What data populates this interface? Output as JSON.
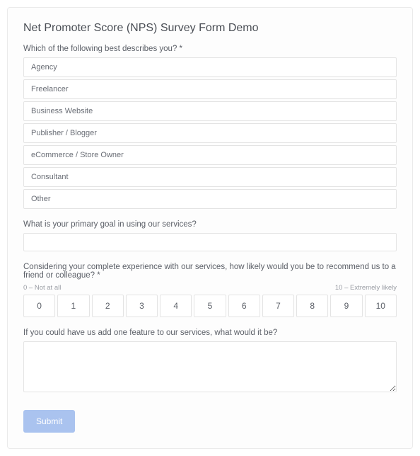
{
  "title": "Net Promoter Score (NPS) Survey Form Demo",
  "q1": {
    "label": "Which of the following best describes you? *",
    "options": [
      "Agency",
      "Freelancer",
      "Business Website",
      "Publisher / Blogger",
      "eCommerce / Store Owner",
      "Consultant",
      "Other"
    ]
  },
  "q2": {
    "label": "What is your primary goal in using our services?",
    "value": ""
  },
  "q3": {
    "label": "Considering your complete experience with our services, how likely would you be to recommend us to a friend or colleague? *",
    "low_label": "0 – Not at all",
    "high_label": "10 – Extremely likely",
    "scale": [
      "0",
      "1",
      "2",
      "3",
      "4",
      "5",
      "6",
      "7",
      "8",
      "9",
      "10"
    ]
  },
  "q4": {
    "label": "If you could have us add one feature to our services, what would it be?",
    "value": ""
  },
  "submit_label": "Submit"
}
